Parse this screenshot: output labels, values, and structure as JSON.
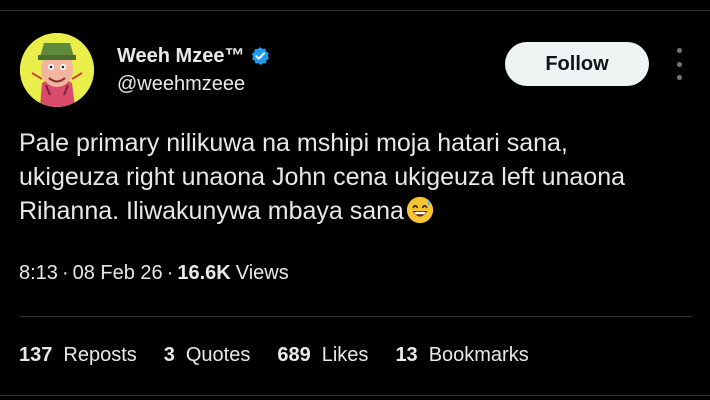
{
  "author": {
    "display_name": "Weeh Mzee™",
    "handle": "@weehmzeee",
    "verified": true,
    "avatar_icon": "cartoon-avatar-icon"
  },
  "actions": {
    "follow_label": "Follow",
    "more_icon": "more-vertical-icon"
  },
  "tweet": {
    "lines": [
      "Pale primary nilikuwa na mshipi moja hatari sana,",
      "ukigeuza right unaona John cena ukigeuza left unaona",
      "Rihanna. Iliwakunywa mbaya sana"
    ],
    "emoji": "grinning-sweat-emoji"
  },
  "meta": {
    "time": "8:13",
    "separator": "·",
    "date": "08 Feb 26",
    "views_count": "16.6K",
    "views_label": "Views"
  },
  "stats": {
    "reposts": {
      "count": "137",
      "label": "Reposts"
    },
    "quotes": {
      "count": "3",
      "label": "Quotes"
    },
    "likes": {
      "count": "689",
      "label": "Likes"
    },
    "bookmarks": {
      "count": "13",
      "label": "Bookmarks"
    }
  },
  "colors": {
    "background": "#000000",
    "text": "#e7e9ea",
    "verified_badge": "#1d9bf0",
    "follow_button_bg": "#eff3f4",
    "divider": "#2f3336"
  }
}
